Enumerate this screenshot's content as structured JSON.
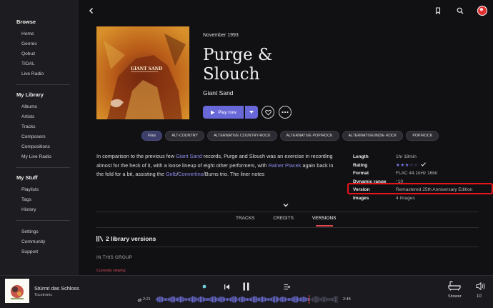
{
  "sidebar": {
    "sections": [
      {
        "title": "Browse",
        "items": [
          "Home",
          "Genres",
          "Qobuz",
          "TIDAL",
          "Live Radio"
        ]
      },
      {
        "title": "My Library",
        "items": [
          "Albums",
          "Artists",
          "Tracks",
          "Composers",
          "Compositions",
          "My Live Radio"
        ]
      },
      {
        "title": "My Stuff",
        "items": [
          "Playlists",
          "Tags",
          "History"
        ]
      }
    ],
    "footer_items": [
      "Settings",
      "Community",
      "Support"
    ]
  },
  "album": {
    "date": "November 1993",
    "title": "Purge & Slouch",
    "artist": "Giant Sand",
    "cover_text": "GIANT SAND",
    "play_label": "Play now"
  },
  "tags": [
    "Files",
    "ALT-COUNTRY",
    "ALTERNATIVE COUNTRY-ROCK",
    "ALTERNATIVE POP/ROCK",
    "ALTERNATIVE/INDIE ROCK",
    "POP/ROCK"
  ],
  "description": {
    "p1": "In comparison to the previous few ",
    "link1": "Giant Sand",
    "p2": " records, Purge and Slouch was an exercise in recording almost for the heck of it, with a loose lineup of eight other performers, with ",
    "link2": "Rainer Ptacek",
    "p3": " again back in the fold for a bit, assisting the ",
    "link3": "Gelb",
    "p4": "/",
    "link4": "Convertino",
    "p5": "/Burns trio. The liner notes"
  },
  "meta": {
    "length_label": "Length",
    "length": "1hr 18min",
    "rating_label": "Rating",
    "rating_stars": "★★★☆☆",
    "format_label": "Format",
    "format": "FLAC 44.1kHz 16bit",
    "dr_label": "Dynamic range",
    "dr": "⁄ 10",
    "version_label": "Version",
    "version": "Remastered 25th Anniversary Edition",
    "images_label": "Images",
    "images": "4 Images"
  },
  "tabs": [
    "TRACKS",
    "CREDITS",
    "VERSIONS"
  ],
  "versions": {
    "heading": "2 library versions",
    "group_label": "IN THIS GROUP",
    "current": "Currently viewing"
  },
  "player": {
    "track_title": "Stürmt das Schloss",
    "track_artist": "Tocotronic",
    "elapsed": "2:21",
    "total": "2:48",
    "progress": 0.84,
    "zone": "Shower",
    "volume": "10"
  },
  "colors": {
    "accent": "#6868d8",
    "highlight": "#e8141c",
    "active_tab": "#e0484f"
  }
}
